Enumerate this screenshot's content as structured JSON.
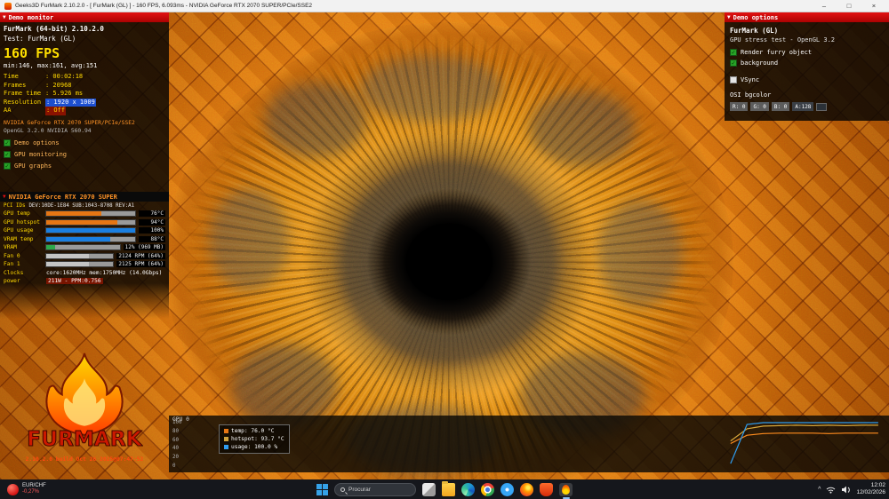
{
  "window": {
    "title": "Geeks3D FurMark 2.10.2.0 - [ FurMark (GL) ] - 160 FPS, 6.093ms - NVIDIA GeForce RTX 2070 SUPER/PCIe/SSE2",
    "minimize": "–",
    "maximize": "□",
    "close": "×"
  },
  "icons": {
    "collapse": "▼",
    "chevron_up": "^"
  },
  "monitor": {
    "header": "Demo monitor",
    "app_name": "FurMark (64-bit) 2.10.2.0",
    "test_line": "Test: FurMark (GL)",
    "fps": "160 FPS",
    "fps_stats": "min:146, max:161, avg:151",
    "rows": [
      {
        "label": "Time",
        "value": ": 00:02:18"
      },
      {
        "label": "Frames",
        "value": ": 20968"
      },
      {
        "label": "Frame time",
        "value": ": 5.926 ms"
      },
      {
        "label": "Resolution",
        "value": ": 1920 x 1009"
      },
      {
        "label": "AA",
        "value": ": Off"
      }
    ],
    "gpu_name": "NVIDIA GeForce RTX 2070 SUPER/PCIe/SSE2",
    "gl_version": "OpenGL 3.2.0 NVIDIA 560.94",
    "checkboxes": [
      {
        "label": "Demo options",
        "mark": "✓"
      },
      {
        "label": "GPU monitoring",
        "mark": "✓"
      },
      {
        "label": "GPU graphs",
        "mark": "✓"
      }
    ]
  },
  "gpu_panel": {
    "header": "NVIDIA GeForce RTX 2070 SUPER",
    "pci_label": "PCI IDs",
    "pci_value": "DEV:10DE-1E84 SUB:1043-8708 REV:A1",
    "meters": [
      {
        "label": "GPU temp",
        "value": "76°C",
        "pct": 62,
        "color": "#e67614"
      },
      {
        "label": "GPU hotspot",
        "value": "94°C",
        "pct": 80,
        "color": "#e67614"
      },
      {
        "label": "GPU usage",
        "value": "100%",
        "pct": 100,
        "color": "#1b7fe0"
      },
      {
        "label": "VRAM temp",
        "value": "88°C",
        "pct": 72,
        "color": "#1b7fe0"
      },
      {
        "label": "VRAM",
        "value": "12% (969 MB)",
        "pct": 12,
        "color": "#2da84a"
      },
      {
        "label": "Fan 0",
        "value": "2124 RPM (64%)",
        "pct": 64,
        "color": "#c4c4c4"
      },
      {
        "label": "Fan 1",
        "value": "2125 RPM (64%)",
        "pct": 64,
        "color": "#c4c4c4"
      }
    ],
    "clocks_label": "Clocks",
    "clocks_value": "core:1620MHz  mem:1750MHz (14.0Gbps)",
    "power_label": "power",
    "power_value": "211W - PPM:0.756"
  },
  "logo": {
    "text": "FURMARK",
    "build": "2.10.2.0 build Oct 26 2025@07:47:52"
  },
  "options": {
    "header": "Demo options",
    "title": "FurMark (GL)",
    "subtitle": "GPU stress test - OpenGL 3.2",
    "checkboxes": [
      {
        "label": "Render furry object",
        "mark": "✓"
      },
      {
        "label": "background",
        "mark": "✓"
      },
      {
        "label": "VSync",
        "mark": ""
      }
    ],
    "bgcolor_label": "OSI bgcolor",
    "channels": [
      {
        "text": "R: 0"
      },
      {
        "text": "G: 0"
      },
      {
        "text": "B: 0"
      },
      {
        "text": "A:128"
      }
    ]
  },
  "graph": {
    "title": "GPU 0",
    "y_ticks": [
      "100",
      "80",
      "60",
      "40",
      "20",
      "0"
    ],
    "legend": [
      {
        "label": "temp: 76.0 °C",
        "color": "#e67614"
      },
      {
        "label": "hotspot: 93.7 °C",
        "color": "#cfa23c"
      },
      {
        "label": "usage: 100.0 %",
        "color": "#2f9df0"
      }
    ],
    "ymax": 100,
    "x_start_frac": 0.78,
    "series": [
      {
        "name": "temp",
        "color": "#ff8c1e",
        "values": [
          52,
          71,
          75,
          76,
          76,
          76,
          75,
          76,
          76,
          76
        ]
      },
      {
        "name": "hotspot",
        "color": "#d8a83c",
        "values": [
          58,
          86,
          92,
          93,
          94,
          93,
          94,
          93,
          94,
          94
        ]
      },
      {
        "name": "usage",
        "color": "#2f9df0",
        "values": [
          6,
          96,
          100,
          100,
          100,
          100,
          100,
          100,
          100,
          100
        ]
      }
    ]
  },
  "taskbar": {
    "widget_pair": "EUR/CHF",
    "widget_change": "-0,27%",
    "search_placeholder": "Procurar",
    "time": "12:02",
    "date": "12/02/2026"
  }
}
